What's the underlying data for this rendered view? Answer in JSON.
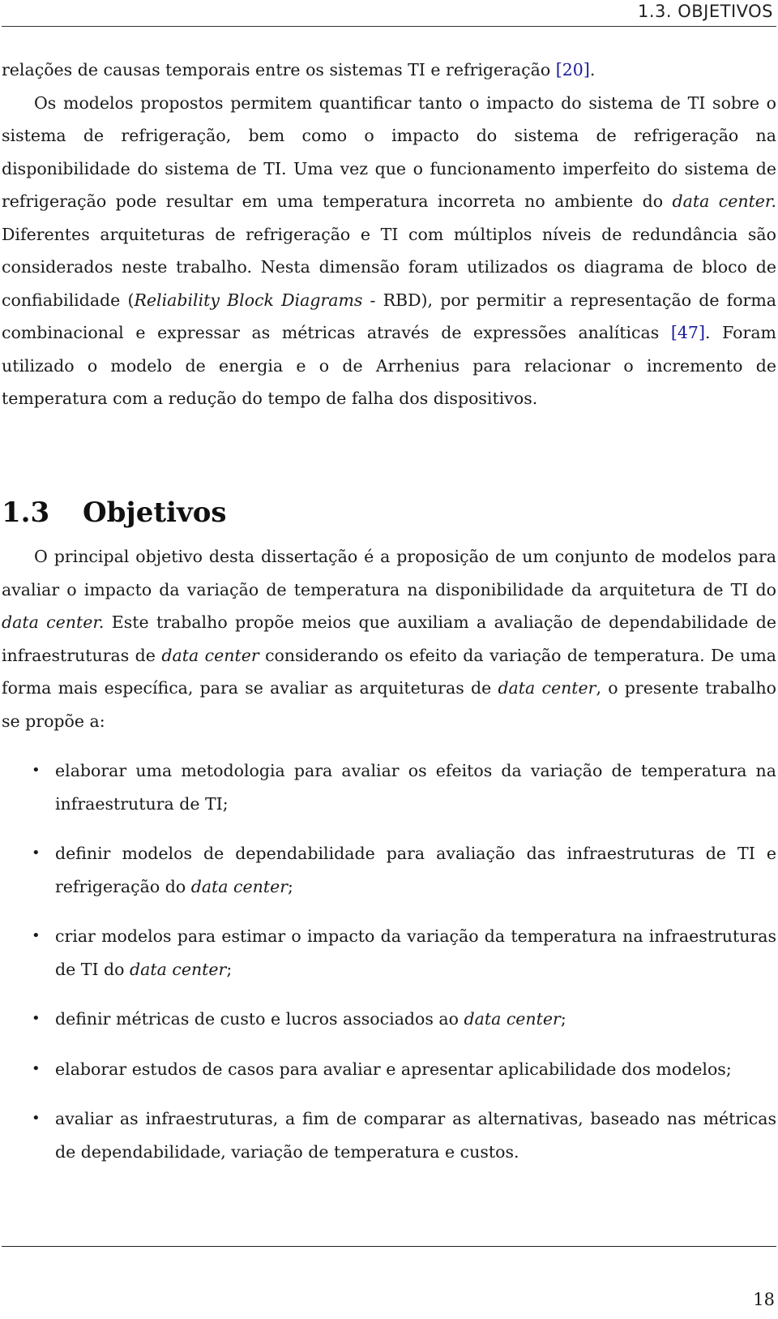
{
  "header": {
    "running_title": "1.3.  OBJETIVOS"
  },
  "intro": {
    "line1_before_cite": "relações de causas temporais entre os sistemas TI e refrigeração ",
    "cite1": "[20]",
    "line1_after": ".",
    "p2_a": "Os modelos propostos permitem quantificar tanto o impacto do sistema de TI sobre o sistema de refrigeração, bem como o impacto do sistema de refrigeração na disponibilidade do sistema de TI. Uma vez que o funcionamento imperfeito do sistema de refrigeração pode resultar em uma temperatura incorreta no ambiente do ",
    "p2_italic1": "data center.",
    "p2_b": " Diferentes arquiteturas de refrigeração e TI com múltiplos níveis de redundância são considerados neste trabalho. Nesta dimensão foram utilizados os diagrama de bloco de confiabilidade (",
    "p2_italic2": "Reliability Block Diagrams",
    "p2_c": " - RBD), por permitir a representação de forma combinacional e expressar as métricas através de expressões analíticas ",
    "cite2": "[47]",
    "p2_d": ". Foram utilizado o modelo de energia e o de Arrhenius para relacionar o incremento de temperatura com a redução do tempo de falha dos dispositivos."
  },
  "section": {
    "number": "1.3",
    "title": "Objetivos"
  },
  "objectives_paragraph": {
    "a": "O principal objetivo desta dissertação é a proposição de um conjunto de modelos para avaliar o impacto da variação de temperatura na disponibilidade da arquitetura de TI do ",
    "i1": "data center.",
    "b": " Este trabalho propõe meios que auxiliam a avaliação de dependabilidade de infraestruturas de ",
    "i2": "data center",
    "c": " considerando os efeito da variação de temperatura.  De uma forma mais específica, para se avaliar as arquiteturas de ",
    "i3": "data center",
    "d": ", o presente trabalho se propõe a:"
  },
  "objectives_list": [
    {
      "text": "elaborar uma metodologia para avaliar os efeitos da variação de temperatura na infraestrutura de TI;",
      "italic": "",
      "tail": ""
    },
    {
      "text": "definir modelos de dependabilidade para avaliação das infraestruturas de TI e refrigeração do ",
      "italic": "data center",
      "tail": ";"
    },
    {
      "text": "criar modelos para estimar o impacto da variação da temperatura na infraestruturas de TI do ",
      "italic": "data center",
      "tail": ";"
    },
    {
      "text": "definir métricas de custo e lucros associados ao ",
      "italic": "data center",
      "tail": ";"
    },
    {
      "text": "elaborar estudos de casos para avaliar e apresentar aplicabilidade dos modelos;",
      "italic": "",
      "tail": ""
    },
    {
      "text": "avaliar as infraestruturas, a fim de comparar as alternativas, baseado nas métricas de dependabilidade, variação de temperatura e custos.",
      "italic": "",
      "tail": ""
    }
  ],
  "bullet_glyph": "•",
  "footer": {
    "page_number": "18"
  },
  "colors": {
    "citation_link": "#1a1a9c",
    "text": "#1a1a1a"
  }
}
